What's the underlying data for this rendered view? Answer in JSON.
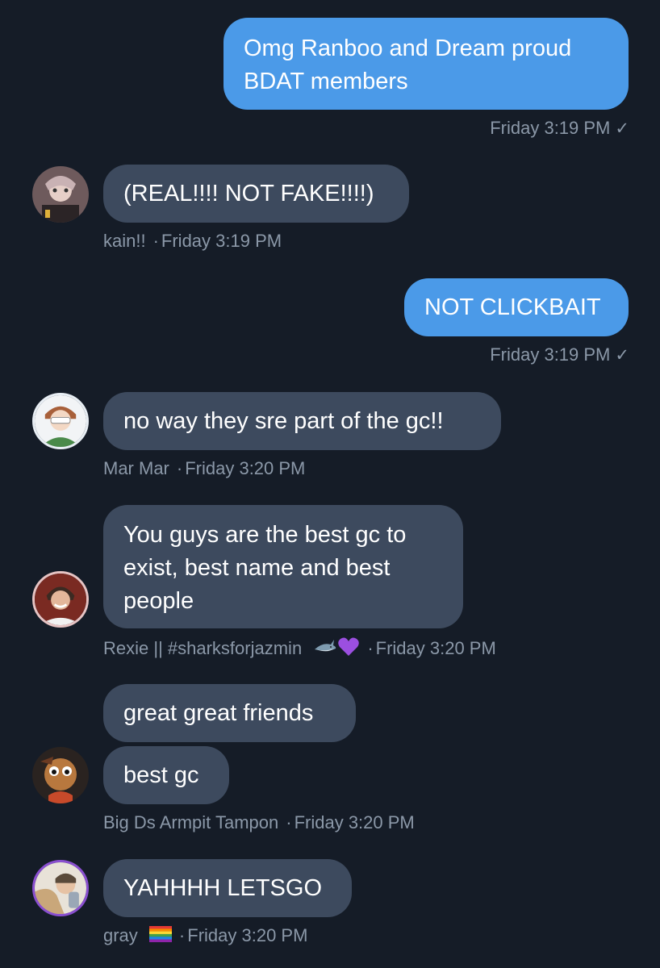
{
  "messages": {
    "m1": {
      "text_l1": "Omg Ranboo and Dream proud",
      "text_l2": "BDAT members",
      "time": "Friday 3:19 PM",
      "check": "✓"
    },
    "m2": {
      "text": "(REAL!!!! NOT FAKE!!!!)",
      "sender": "kain!!",
      "time": "Friday 3:19 PM",
      "sep": "·"
    },
    "m3": {
      "text": "NOT CLICKBAIT",
      "time": "Friday 3:19 PM",
      "check": "✓"
    },
    "m4": {
      "text": "no way they sre part of the gc!!",
      "sender": "Mar Mar",
      "time": "Friday 3:20 PM",
      "sep": "·"
    },
    "m5": {
      "text_l1": "You guys are the best gc to",
      "text_l2": "exist, best name and best",
      "text_l3": "people",
      "sender": "Rexie || #sharksforjazmin",
      "time": "Friday 3:20 PM",
      "sep": "·"
    },
    "m6": {
      "text": "great great friends"
    },
    "m7": {
      "text": "best gc",
      "sender": "Big Ds Armpit Tampon",
      "time": "Friday 3:20 PM",
      "sep": "·"
    },
    "m8": {
      "text": "YAHHHH LETSGO",
      "sender": "gray",
      "time": "Friday 3:20 PM",
      "sep": "·"
    }
  },
  "icons": {
    "read_check": "check-icon",
    "shark": "shark-emoji-icon",
    "purple_heart": "purple-heart-emoji-icon",
    "rainbow_flag": "rainbow-flag-emoji-icon"
  },
  "colors": {
    "background": "#151c27",
    "outgoing_bubble": "#4b9ae8",
    "incoming_bubble": "#3d4a5e",
    "meta_text": "#8b98a8"
  }
}
